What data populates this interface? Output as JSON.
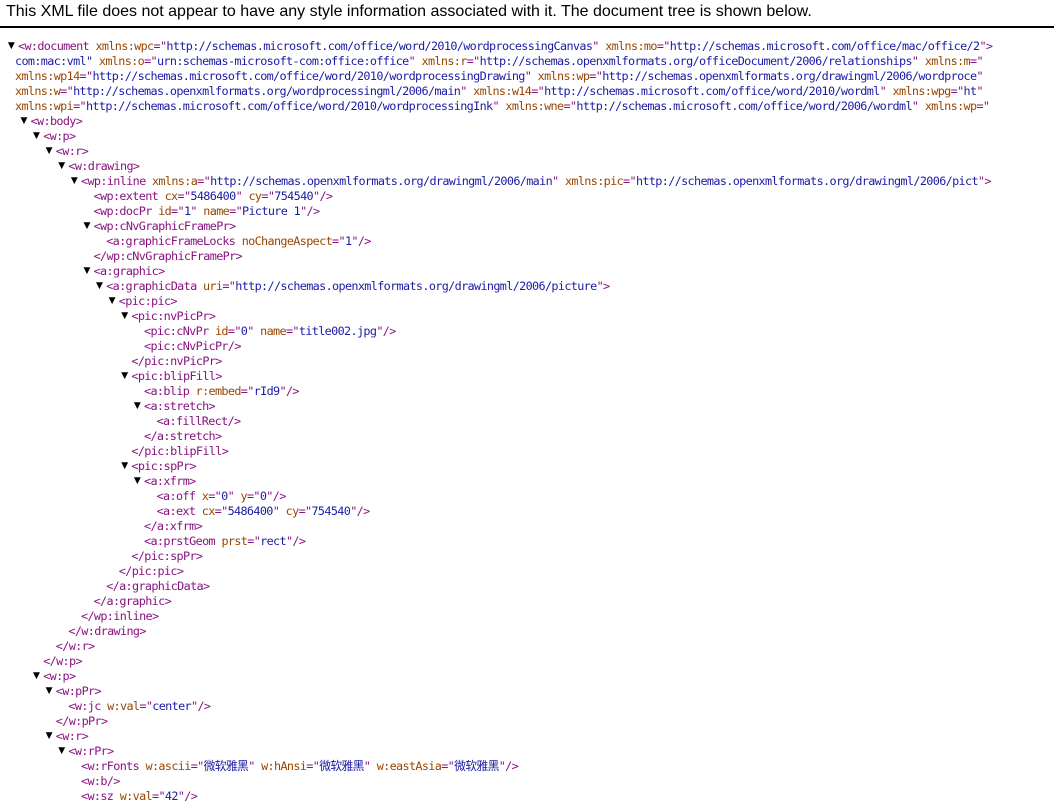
{
  "banner": "This XML file does not appear to have any style information associated with it. The document tree is shown below.",
  "icons": {
    "expanded_toggle": "triangle-down-icon"
  },
  "colors": {
    "tag": "#881280",
    "attr_name": "#994500",
    "attr_value": "#1a1aa6"
  },
  "lines": [
    {
      "d": 0,
      "toggle": true,
      "name": "w:document",
      "attrs": [
        {
          "n": "xmlns:wpc",
          "v": "http://schemas.microsoft.com/office/word/2010/wordprocessingCanvas"
        },
        {
          "n": "xmlns:mo",
          "v": "http://schemas.microsoft.com/office/mac/office/2"
        }
      ]
    },
    {
      "d": 0,
      "cont": true,
      "text": "com:mac:vml\"",
      "attrs": [
        {
          "n": "xmlns:o",
          "v": "urn:schemas-microsoft-com:office:office"
        },
        {
          "n": "xmlns:r",
          "v": "http://schemas.openxmlformats.org/officeDocument/2006/relationships"
        },
        {
          "n": "xmlns:m",
          "v": ""
        }
      ]
    },
    {
      "d": 0,
      "cont": true,
      "attrs": [
        {
          "n": "xmlns:wp14",
          "v": "http://schemas.microsoft.com/office/word/2010/wordprocessingDrawing"
        },
        {
          "n": "xmlns:wp",
          "v": "http://schemas.openxmlformats.org/drawingml/2006/wordproce"
        }
      ]
    },
    {
      "d": 0,
      "cont": true,
      "attrs": [
        {
          "n": "xmlns:w",
          "v": "http://schemas.openxmlformats.org/wordprocessingml/2006/main"
        },
        {
          "n": "xmlns:w14",
          "v": "http://schemas.microsoft.com/office/word/2010/wordml"
        },
        {
          "n": "xmlns:wpg",
          "v": "ht"
        }
      ]
    },
    {
      "d": 0,
      "cont": true,
      "attrs": [
        {
          "n": "xmlns:wpi",
          "v": "http://schemas.microsoft.com/office/word/2010/wordprocessingInk"
        },
        {
          "n": "xmlns:wne",
          "v": "http://schemas.microsoft.com/office/word/2006/wordml"
        },
        {
          "n": "xmlns:wp",
          "v": ""
        }
      ]
    },
    {
      "d": 1,
      "toggle": true,
      "name": "w:body"
    },
    {
      "d": 2,
      "toggle": true,
      "name": "w:p"
    },
    {
      "d": 3,
      "toggle": true,
      "name": "w:r"
    },
    {
      "d": 4,
      "toggle": true,
      "name": "w:drawing"
    },
    {
      "d": 5,
      "toggle": true,
      "name": "wp:inline",
      "attrs": [
        {
          "n": "xmlns:a",
          "v": "http://schemas.openxmlformats.org/drawingml/2006/main"
        },
        {
          "n": "xmlns:pic",
          "v": "http://schemas.openxmlformats.org/drawingml/2006/pict"
        }
      ]
    },
    {
      "d": 6,
      "name": "wp:extent",
      "attrs": [
        {
          "n": "cx",
          "v": "5486400"
        },
        {
          "n": "cy",
          "v": "754540"
        }
      ],
      "self": true
    },
    {
      "d": 6,
      "name": "wp:docPr",
      "attrs": [
        {
          "n": "id",
          "v": "1"
        },
        {
          "n": "name",
          "v": "Picture 1"
        }
      ],
      "self": true
    },
    {
      "d": 6,
      "toggle": true,
      "name": "wp:cNvGraphicFramePr"
    },
    {
      "d": 7,
      "name": "a:graphicFrameLocks",
      "attrs": [
        {
          "n": "noChangeAspect",
          "v": "1"
        }
      ],
      "self": true
    },
    {
      "d": 6,
      "close": true,
      "name": "wp:cNvGraphicFramePr"
    },
    {
      "d": 6,
      "toggle": true,
      "name": "a:graphic"
    },
    {
      "d": 7,
      "toggle": true,
      "name": "a:graphicData",
      "attrs": [
        {
          "n": "uri",
          "v": "http://schemas.openxmlformats.org/drawingml/2006/picture"
        }
      ]
    },
    {
      "d": 8,
      "toggle": true,
      "name": "pic:pic"
    },
    {
      "d": 9,
      "toggle": true,
      "name": "pic:nvPicPr"
    },
    {
      "d": 10,
      "name": "pic:cNvPr",
      "attrs": [
        {
          "n": "id",
          "v": "0"
        },
        {
          "n": "name",
          "v": "title002.jpg"
        }
      ],
      "self": true
    },
    {
      "d": 10,
      "name": "pic:cNvPicPr",
      "self": true
    },
    {
      "d": 9,
      "close": true,
      "name": "pic:nvPicPr"
    },
    {
      "d": 9,
      "toggle": true,
      "name": "pic:blipFill"
    },
    {
      "d": 10,
      "name": "a:blip",
      "attrs": [
        {
          "n": "r:embed",
          "v": "rId9"
        }
      ],
      "self": true
    },
    {
      "d": 10,
      "toggle": true,
      "name": "a:stretch"
    },
    {
      "d": 11,
      "name": "a:fillRect",
      "self": true
    },
    {
      "d": 10,
      "close": true,
      "name": "a:stretch"
    },
    {
      "d": 9,
      "close": true,
      "name": "pic:blipFill"
    },
    {
      "d": 9,
      "toggle": true,
      "name": "pic:spPr"
    },
    {
      "d": 10,
      "toggle": true,
      "name": "a:xfrm"
    },
    {
      "d": 11,
      "name": "a:off",
      "attrs": [
        {
          "n": "x",
          "v": "0"
        },
        {
          "n": "y",
          "v": "0"
        }
      ],
      "self": true
    },
    {
      "d": 11,
      "name": "a:ext",
      "attrs": [
        {
          "n": "cx",
          "v": "5486400"
        },
        {
          "n": "cy",
          "v": "754540"
        }
      ],
      "self": true
    },
    {
      "d": 10,
      "close": true,
      "name": "a:xfrm"
    },
    {
      "d": 10,
      "name": "a:prstGeom",
      "attrs": [
        {
          "n": "prst",
          "v": "rect"
        }
      ],
      "self": true
    },
    {
      "d": 9,
      "close": true,
      "name": "pic:spPr"
    },
    {
      "d": 8,
      "close": true,
      "name": "pic:pic"
    },
    {
      "d": 7,
      "close": true,
      "name": "a:graphicData"
    },
    {
      "d": 6,
      "close": true,
      "name": "a:graphic"
    },
    {
      "d": 5,
      "close": true,
      "name": "wp:inline"
    },
    {
      "d": 4,
      "close": true,
      "name": "w:drawing"
    },
    {
      "d": 3,
      "close": true,
      "name": "w:r"
    },
    {
      "d": 2,
      "close": true,
      "name": "w:p"
    },
    {
      "d": 2,
      "toggle": true,
      "name": "w:p"
    },
    {
      "d": 3,
      "toggle": true,
      "name": "w:pPr"
    },
    {
      "d": 4,
      "name": "w:jc",
      "attrs": [
        {
          "n": "w:val",
          "v": "center"
        }
      ],
      "self": true
    },
    {
      "d": 3,
      "close": true,
      "name": "w:pPr"
    },
    {
      "d": 3,
      "toggle": true,
      "name": "w:r"
    },
    {
      "d": 4,
      "toggle": true,
      "name": "w:rPr"
    },
    {
      "d": 5,
      "name": "w:rFonts",
      "attrs": [
        {
          "n": "w:ascii",
          "v": "微软雅黑"
        },
        {
          "n": "w:hAnsi",
          "v": "微软雅黑"
        },
        {
          "n": "w:eastAsia",
          "v": "微软雅黑"
        }
      ],
      "self": true
    },
    {
      "d": 5,
      "name": "w:b",
      "self": true
    },
    {
      "d": 5,
      "name": "w:sz",
      "attrs": [
        {
          "n": "w:val",
          "v": "42"
        }
      ],
      "self": true
    }
  ]
}
